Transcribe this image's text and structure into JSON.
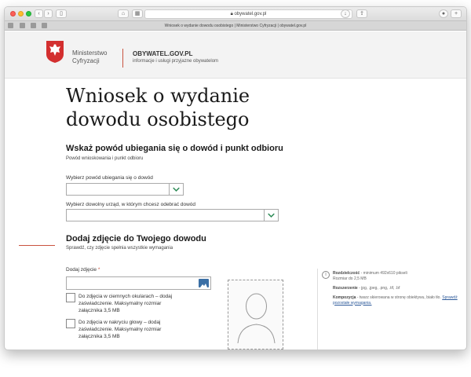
{
  "browser": {
    "url": "obywatel.gov.pl",
    "tab_title": "Wniosek o wydanie dowodu osobistego | Ministerstwo Cyfryzacji | obywatel.gov.pl"
  },
  "header": {
    "ministry_line1": "Ministerstwo",
    "ministry_line2": "Cyfryzacji",
    "site_name": "OBYWATEL.GOV.PL",
    "site_tagline": "informacje i usługi przyjazne obywatelom"
  },
  "main": {
    "title_line1": "Wniosek o wydanie",
    "title_line2": "dowodu osobistego",
    "section1": {
      "heading": "Wskaż powód ubiegania się o dowód i punkt odbioru",
      "subheading": "Powód wnioskowania i punkt odbioru",
      "reason_label": "Wybierz powód ubiegania się o dowód",
      "office_label": "Wybierz dowolny urząd, w którym chcesz odebrać dowód"
    },
    "section2": {
      "heading": "Dodaj zdjęcie do Twojego dowodu",
      "subheading": "Sprawdź, czy zdjęcie spełnia wszystkie wymagania",
      "photo_label": "Dodaj zdjęcie",
      "required_mark": "*",
      "checkbox1": "Do zdjęcia w ciemnych okularach – dodaj zaświadczenie. Maksymalny rozmiar załącznika 3,5 MB",
      "checkbox2": "Do zdjęcia w nakryciu głowy – dodaj zaświadczenie. Maksymalny rozmiar załącznika 3,5 MB"
    },
    "info": {
      "resolution_label": "Rozdzielczość",
      "resolution_text": "- minimum 492x610 pikseli",
      "size_text": "Rozmiar do 2,5 MB",
      "ext_label": "Rozszerzenie",
      "ext_text": "- jpg, .jpeg, .png, .tif, .bf",
      "comp_label": "Kompozycja",
      "comp_text": "- twarz skierowana w stronę obiektywu, biało tło.",
      "comp_link": "Sprawdź pozostałe wymagania."
    }
  }
}
